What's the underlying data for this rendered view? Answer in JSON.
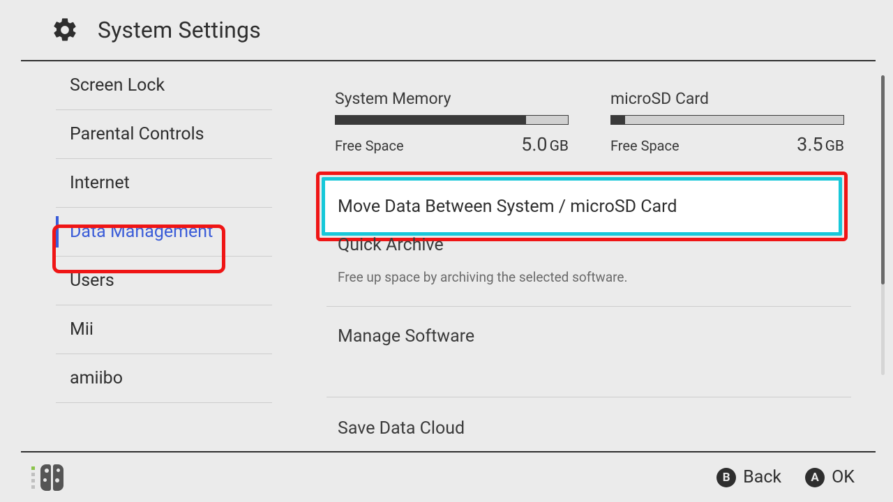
{
  "header": {
    "title": "System Settings"
  },
  "sidebar": {
    "items": [
      {
        "label": "Screen Lock"
      },
      {
        "label": "Parental Controls"
      },
      {
        "label": "Internet"
      },
      {
        "label": "Data Management"
      },
      {
        "label": "Users"
      },
      {
        "label": "Mii"
      },
      {
        "label": "amiibo"
      }
    ],
    "selected_index": 3
  },
  "storage": {
    "system": {
      "title": "System Memory",
      "free_label": "Free Space",
      "free_value": "5.0",
      "free_unit": "GB",
      "used_fraction": 0.82
    },
    "sd": {
      "title": "microSD Card",
      "free_label": "Free Space",
      "free_value": "3.5",
      "free_unit": "GB",
      "used_fraction": 0.06
    }
  },
  "options": {
    "move_data": {
      "title": "Move Data Between System / microSD Card"
    },
    "quick_archive": {
      "title": "Quick Archive",
      "subtitle": "Free up space by archiving the selected software."
    },
    "manage_software": {
      "title": "Manage Software"
    },
    "save_data_cloud": {
      "title": "Save Data Cloud"
    }
  },
  "footer": {
    "back_glyph": "B",
    "back_label": "Back",
    "ok_glyph": "A",
    "ok_label": "OK"
  }
}
